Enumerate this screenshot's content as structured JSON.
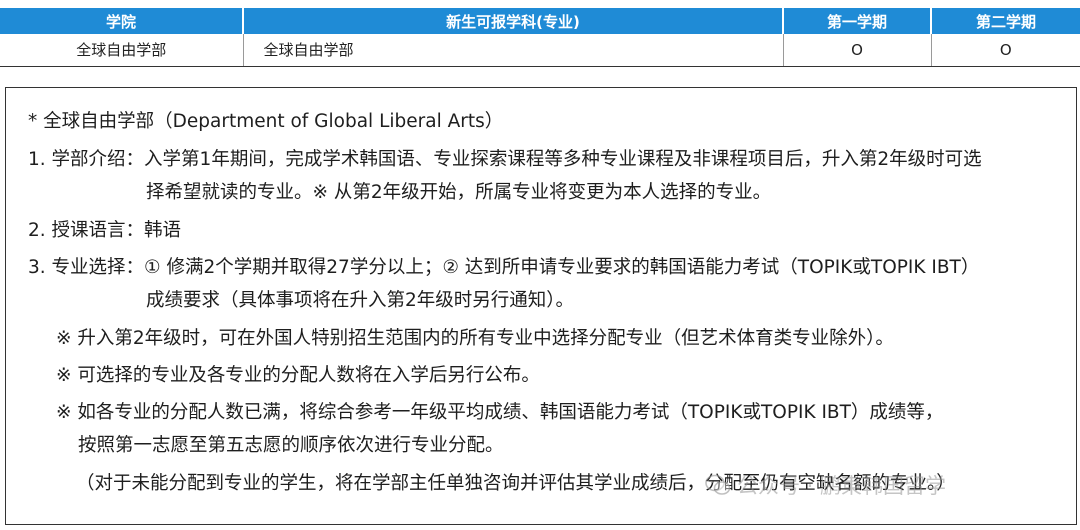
{
  "table": {
    "headers": [
      "学院",
      "新生可报学科(专业)",
      "第一学期",
      "第二学期"
    ],
    "rows": [
      [
        "全球自由学部",
        "全球自由学部",
        "O",
        "O"
      ]
    ]
  },
  "notes": {
    "title": "* 全球自由学部（Department of Global Liberal Arts）",
    "item1_label": "1. 学部介绍：",
    "item1_text": "入学第1年期间，完成学术韩国语、专业探索课程等多种专业课程及非课程项目后，升入第2年级时可选",
    "item1_cont": "择希望就读的专业。※ 从第2年级开始，所属专业将变更为本人选择的专业。",
    "item2_label": "2. 授课语言：",
    "item2_text": "韩语",
    "item3_label": "3. 专业选择：",
    "item3_text": "① 修满2个学期并取得27学分以上；② 达到所申请专业要求的韩国语能力考试（TOPIK或TOPIK IBT）",
    "item3_cont": "成绩要求（具体事项将在升入第2年级时另行通知）。",
    "note1": "※ 升入第2年级时，可在外国人特别招生范围内的所有专业中选择分配专业（但艺术体育类专业除外）。",
    "note2": "※ 可选择的专业及各专业的分配人数将在入学后另行公布。",
    "note3": "※ 如各专业的分配人数已满，将综合参考一年级平均成绩、韩国语能力考试（TOPIK或TOPIK IBT）成绩等，",
    "note3_cont": "按照第一志愿至第五志愿的顺序依次进行专业分配。",
    "note4": "（对于未能分配到专业的学生，将在学部主任单独咨询并评估其学业成绩后，分配至仍有空缺名额的专业。）"
  },
  "watermark": {
    "text": "公众号 · 鹏東韩国留学",
    "icon": "wechat-icon"
  }
}
